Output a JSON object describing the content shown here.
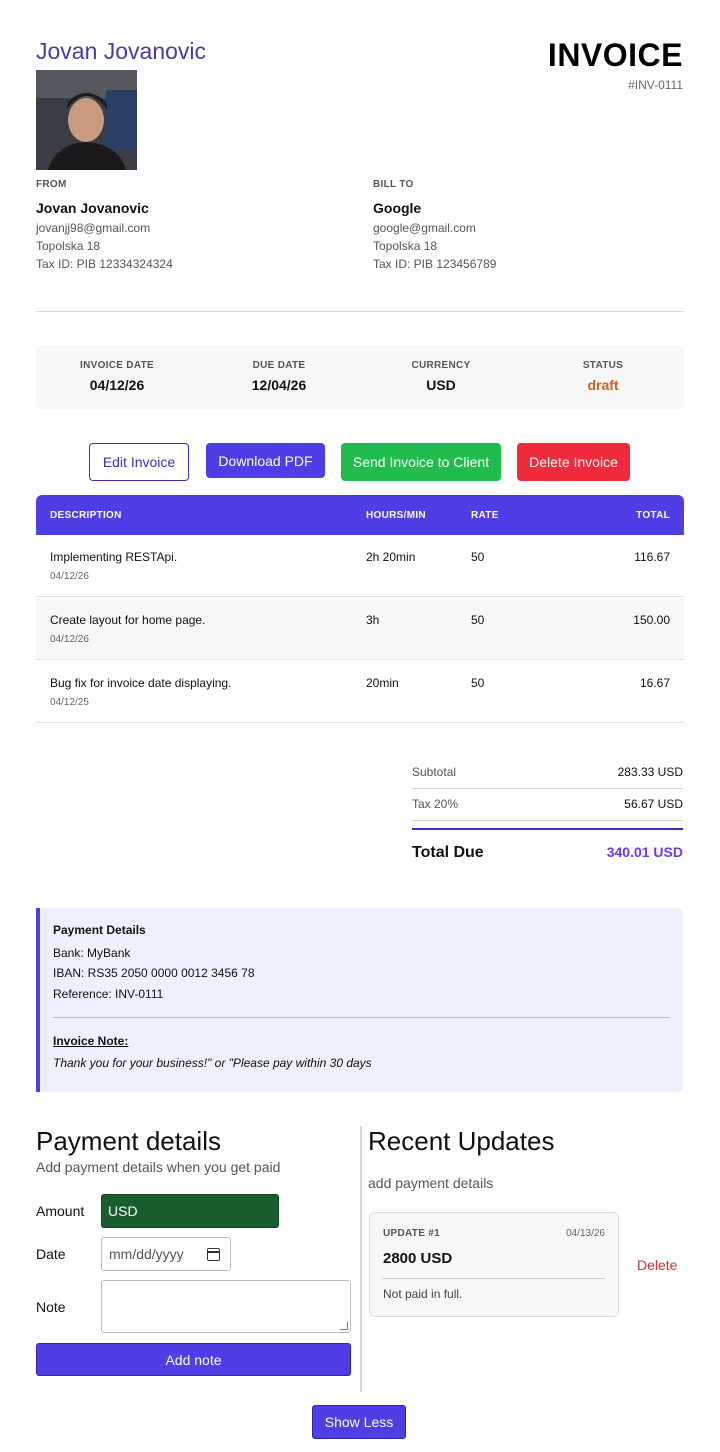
{
  "header": {
    "sender_name": "Jovan Jovanovic",
    "title": "INVOICE",
    "invoice_number": "#INV-0111"
  },
  "from": {
    "label": "FROM",
    "name": "Jovan Jovanovic",
    "email": "jovanjj98@gmail.com",
    "address": "Topolska 18",
    "tax_id": "Tax ID: PIB 12334324324"
  },
  "bill_to": {
    "label": "BILL TO",
    "name": "Google",
    "email": "google@gmail.com",
    "address": "Topolska 18",
    "tax_id": "Tax ID: PIB 123456789"
  },
  "meta": [
    {
      "label": "INVOICE DATE",
      "value": "04/12/26"
    },
    {
      "label": "DUE DATE",
      "value": "12/04/26"
    },
    {
      "label": "CURRENCY",
      "value": "USD"
    },
    {
      "label": "STATUS",
      "value": "draft"
    }
  ],
  "actions": {
    "edit": "Edit Invoice",
    "download": "Download PDF",
    "send": "Send Invoice to Client",
    "delete": "Delete Invoice"
  },
  "table": {
    "columns": {
      "description": "DESCRIPTION",
      "hours": "HOURS/MIN",
      "rate": "RATE",
      "total": "TOTAL"
    },
    "rows": [
      {
        "description": "Implementing RESTApi.",
        "date": "04/12/26",
        "hours": "2h 20min",
        "rate": "50",
        "total": "116.67"
      },
      {
        "description": "Create layout for home page.",
        "date": "04/12/26",
        "hours": "3h",
        "rate": "50",
        "total": "150.00"
      },
      {
        "description": "Bug fix for invoice date displaying.",
        "date": "04/12/25",
        "hours": "20min",
        "rate": "50",
        "total": "16.67"
      }
    ]
  },
  "totals": {
    "subtotal_label": "Subtotal",
    "subtotal_value": "283.33 USD",
    "tax_label": "Tax 20%",
    "tax_value": "56.67 USD",
    "due_label": "Total Due",
    "due_value": "340.01 USD"
  },
  "payment_info": {
    "title": "Payment Details",
    "bank": "Bank: MyBank",
    "iban": "IBAN: RS35 2050 0000 0012 3456 78",
    "reference": "Reference: INV-0111",
    "note_title": "Invoice Note:",
    "note_body": "Thank you for your business!\" or \"Please pay within 30 days"
  },
  "payment_form": {
    "title": "Payment details",
    "subtitle": "Add payment details when you get paid",
    "amount_label": "Amount",
    "amount_value": "USD",
    "date_label": "Date",
    "date_placeholder": "mm/dd/yyyy",
    "note_label": "Note",
    "submit": "Add note"
  },
  "updates": {
    "title": "Recent Updates",
    "subtitle": "add payment details",
    "items": [
      {
        "label": "UPDATE #1",
        "date": "04/13/26",
        "amount": "2800 USD",
        "message": "Not paid in full.",
        "delete_label": "Delete"
      }
    ]
  },
  "footer": {
    "show_less": "Show Less"
  },
  "colors": {
    "accent": "#4f3ee6",
    "status_draft": "#d35f1a",
    "send": "#22bb4e",
    "danger": "#ee2a3c",
    "amount_field": "#1b5c2e"
  }
}
